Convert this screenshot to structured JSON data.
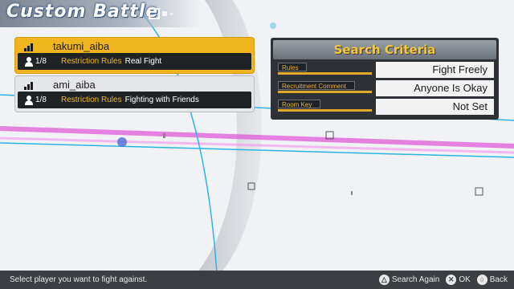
{
  "title": "Custom Battle",
  "rooms": [
    {
      "host": "takumi_aiba",
      "players": "1/8",
      "restriction_label": "Restriction Rules",
      "restriction_value": "Real Fight",
      "selected": true
    },
    {
      "host": "ami_aiba",
      "players": "1/8",
      "restriction_label": "Restriction Rules",
      "restriction_value": "Fighting with Friends",
      "selected": false
    }
  ],
  "criteria": {
    "title": "Search Criteria",
    "rows": [
      {
        "label": "Rules",
        "value": "Fight Freely"
      },
      {
        "label": "Recruitment Comment",
        "value": "Anyone Is Okay"
      },
      {
        "label": "Room Key",
        "value": "Not Set"
      }
    ]
  },
  "footer": {
    "help_text": "Select player you want to fight against.",
    "actions": [
      {
        "icon": "triangle-button-icon",
        "glyph": "△",
        "label": "Search Again"
      },
      {
        "icon": "cross-button-icon",
        "glyph": "✕",
        "label": "OK"
      },
      {
        "icon": "circle-button-icon",
        "glyph": "○",
        "label": "Back"
      }
    ]
  },
  "colors": {
    "accent_gold": "#f0b51c",
    "panel_dark": "#202326",
    "background": "#f1f2f5",
    "line_cyan": "#2bb4e3",
    "line_magenta": "#e05ad8"
  }
}
